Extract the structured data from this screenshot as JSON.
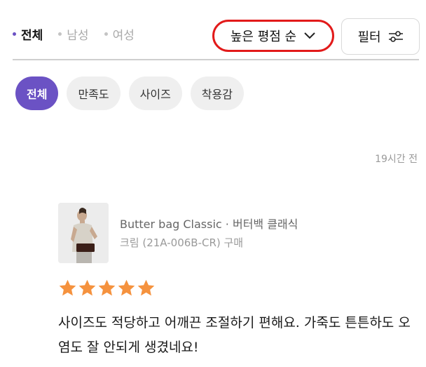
{
  "gender_tabs": [
    {
      "label": "전체",
      "active": true
    },
    {
      "label": "남성",
      "active": false
    },
    {
      "label": "여성",
      "active": false
    }
  ],
  "sort": {
    "label": "높은 평점 순",
    "icon": "chevron-down-icon"
  },
  "filter": {
    "label": "필터",
    "icon": "sliders-icon"
  },
  "category_chips": [
    {
      "label": "전체",
      "active": true
    },
    {
      "label": "만족도",
      "active": false
    },
    {
      "label": "사이즈",
      "active": false
    },
    {
      "label": "착용감",
      "active": false
    }
  ],
  "review": {
    "timestamp": "19시간 전",
    "product_name": "Butter bag Classic · 버터백 클래식",
    "product_option": "크림 (21A-006B-CR) 구매",
    "rating": 5,
    "rating_max": 5,
    "text": "사이즈도 적당하고 어깨끈 조절하기 편해요. 가죽도 튼튼하도 오염도 잘 안되게 생겼네요!"
  },
  "colors": {
    "accent": "#6b52c4",
    "star": "#f5923e",
    "highlight": "#e21a1a"
  }
}
